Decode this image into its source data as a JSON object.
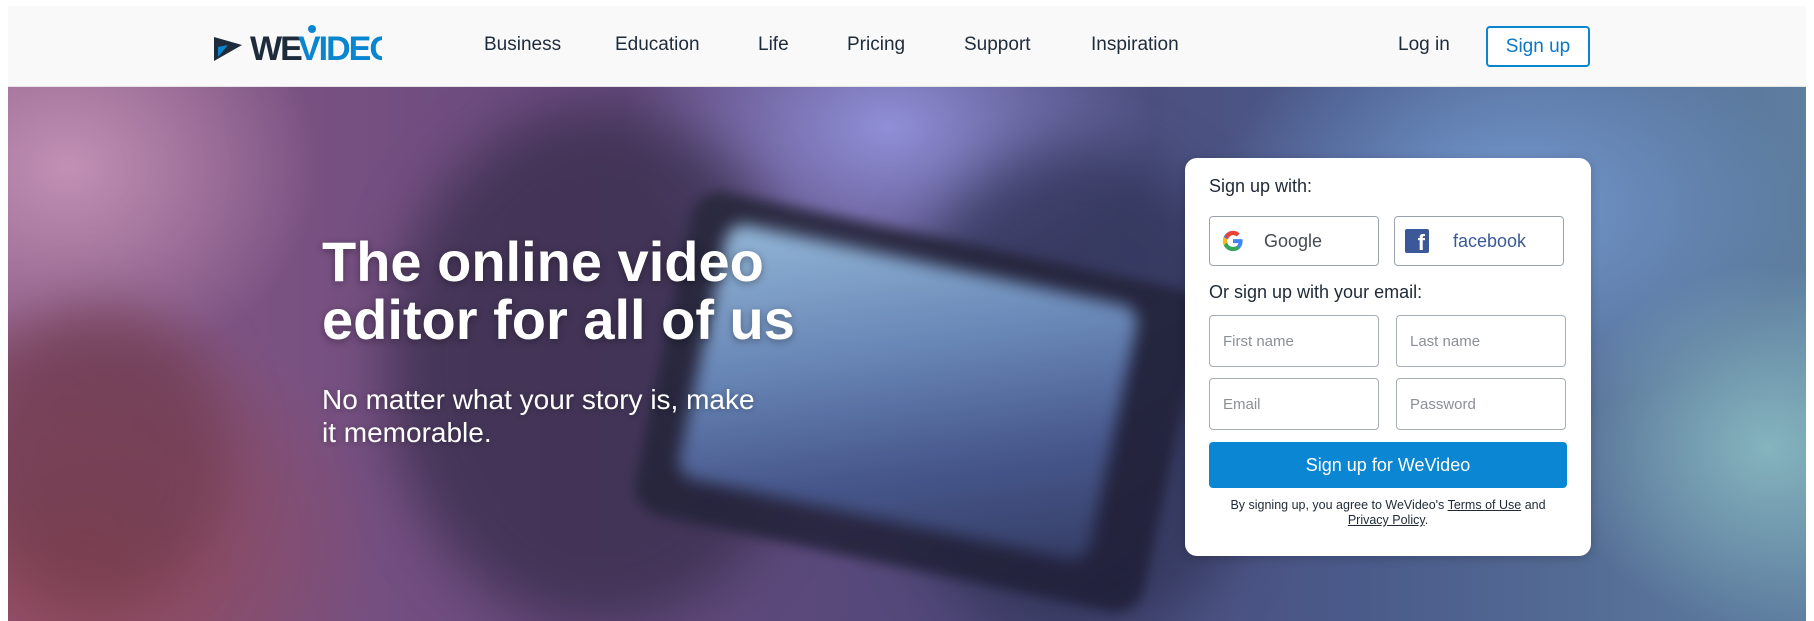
{
  "header": {
    "logo_alt": "WeVideo",
    "nav": [
      {
        "label": "Business"
      },
      {
        "label": "Education"
      },
      {
        "label": "Life"
      },
      {
        "label": "Pricing"
      },
      {
        "label": "Support"
      },
      {
        "label": "Inspiration"
      }
    ],
    "login_label": "Log in",
    "signup_label": "Sign up"
  },
  "hero": {
    "title_line1": "The online video",
    "title_line2": "editor for all of us",
    "subtitle_line1": "No matter what your story is, make",
    "subtitle_line2": "it memorable."
  },
  "signup": {
    "heading": "Sign up with:",
    "google_label": "Google",
    "facebook_label": "facebook",
    "email_heading": "Or sign up with your email:",
    "first_name_placeholder": "First name",
    "last_name_placeholder": "Last name",
    "email_placeholder": "Email",
    "password_placeholder": "Password",
    "submit_label": "Sign up for WeVideo",
    "terms_prefix": "By signing up, you agree to WeVideo's",
    "terms_link": "Terms of Use",
    "terms_and": "and",
    "privacy_link": "Privacy Policy",
    "terms_suffix": "."
  },
  "colors": {
    "brand_dark": "#1d2b3a",
    "brand_blue": "#0b86d3",
    "facebook_blue": "#3b5998"
  },
  "icons": {
    "logo": "wevideo-play-icon",
    "google": "google-g-icon",
    "facebook": "facebook-f-icon"
  }
}
